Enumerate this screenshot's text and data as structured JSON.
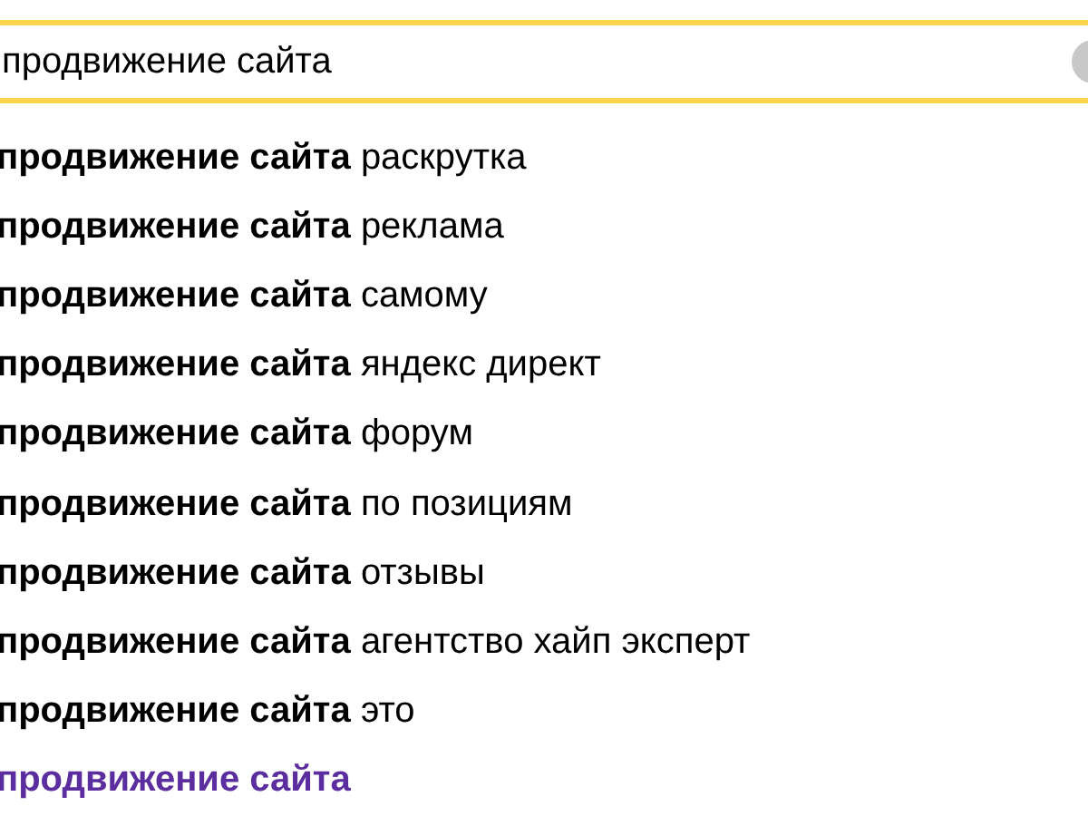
{
  "search": {
    "value": "продвижение сайта"
  },
  "suggestions": [
    {
      "match": "продвижение сайта",
      "suffix": "раскрутка",
      "visited": false
    },
    {
      "match": "продвижение сайта",
      "suffix": "реклама",
      "visited": false
    },
    {
      "match": "продвижение сайта",
      "suffix": "самому",
      "visited": false
    },
    {
      "match": "продвижение сайта",
      "suffix": "яндекс директ",
      "visited": false
    },
    {
      "match": "продвижение сайта",
      "suffix": "форум",
      "visited": false
    },
    {
      "match": "продвижение сайта",
      "suffix": "по позициям",
      "visited": false
    },
    {
      "match": "продвижение сайта",
      "suffix": "отзывы",
      "visited": false
    },
    {
      "match": "продвижение сайта",
      "suffix": "агентство хайп эксперт",
      "visited": false
    },
    {
      "match": "продвижение сайта",
      "suffix": "это",
      "visited": false
    },
    {
      "match": "продвижение сайта",
      "visited": true
    }
  ]
}
